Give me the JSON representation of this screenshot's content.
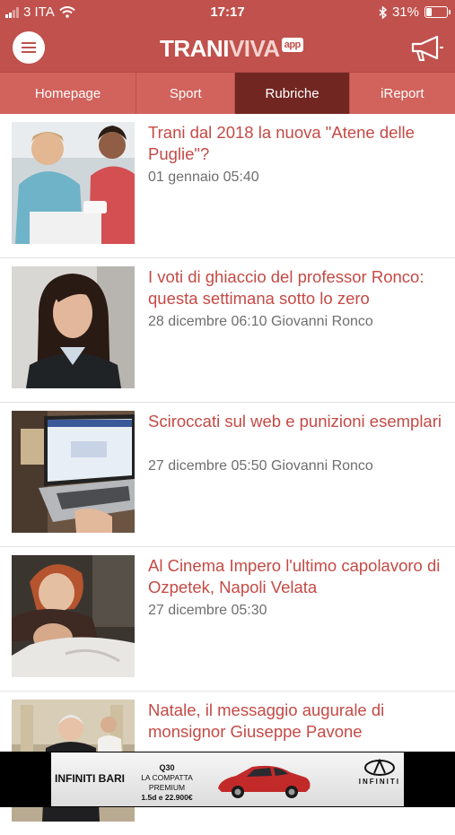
{
  "status": {
    "carrier": "3 ITA",
    "time": "17:17",
    "battery": "31%"
  },
  "header": {
    "logo_trani": "TRANI",
    "logo_viva": "VIVA",
    "logo_app": "app"
  },
  "tabs": [
    {
      "label": "Homepage",
      "active": false
    },
    {
      "label": "Sport",
      "active": false
    },
    {
      "label": "Rubriche",
      "active": true
    },
    {
      "label": "iReport",
      "active": false
    }
  ],
  "articles": [
    {
      "title": "Trani dal 2018 la nuova \"Atene delle Puglie\"?",
      "meta": "01 gennaio 05:40"
    },
    {
      "title": "I voti di ghiaccio del professor Ronco: questa settimana sotto lo zero",
      "meta": "28 dicembre 06:10 Giovanni Ronco"
    },
    {
      "title": "Sciroccati sul web e punizioni esemplari",
      "meta": "27 dicembre 05:50 Giovanni Ronco"
    },
    {
      "title": "Al Cinema Impero l'ultimo capolavoro di Ozpetek, Napoli Velata",
      "meta": "27 dicembre 05:30"
    },
    {
      "title": "Natale, il messaggio augurale di monsignor Giuseppe Pavone",
      "meta": ""
    }
  ],
  "ad": {
    "dealer": "INFINITI BARI",
    "model": "Q30",
    "tagline": "LA COMPATTA PREMIUM",
    "price": "1.5d e 22.900€",
    "brand": "INFINITI"
  },
  "colors": {
    "accent": "#c0514c",
    "tab_bg": "#d2625c",
    "tab_active": "#722622",
    "title": "#c44a45"
  }
}
